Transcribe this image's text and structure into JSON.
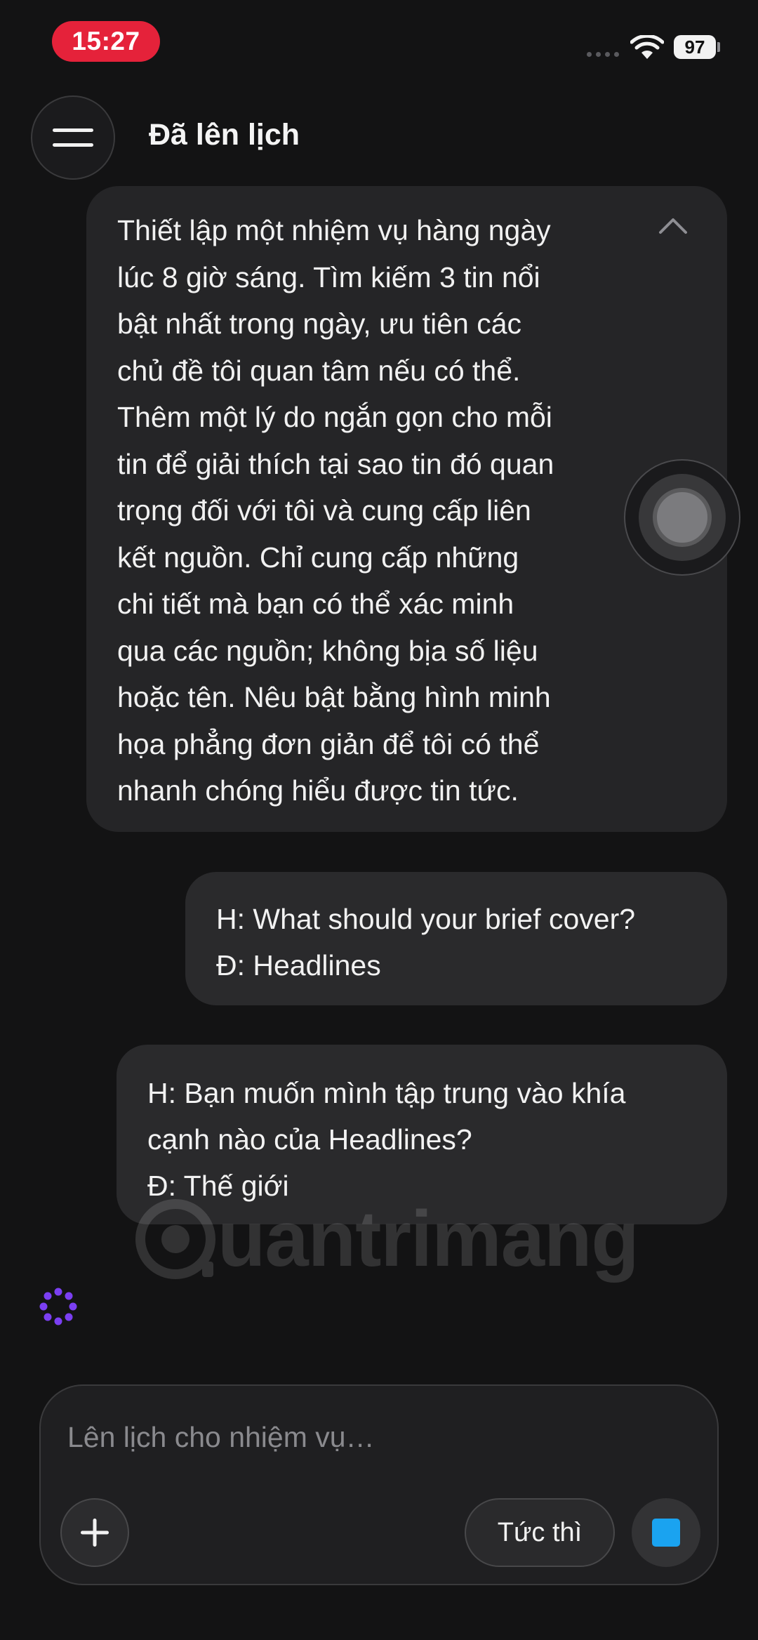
{
  "status_bar": {
    "time": "15:27",
    "battery": "97"
  },
  "header": {
    "title": "Đã lên lịch",
    "menu_icon": "hamburger-icon"
  },
  "prompt": {
    "lines": [
      "Thiết lập một nhiệm vụ hàng ngày",
      "lúc 8 giờ sáng. Tìm kiếm 3 tin nổi",
      "bật nhất trong ngày, ưu tiên các",
      "chủ đề tôi quan tâm nếu có thể.",
      "Thêm một lý do ngắn gọn cho mỗi",
      "tin để giải thích tại sao tin đó quan",
      "trọng đối với tôi và cung cấp liên",
      "kết nguồn. Chỉ cung cấp những",
      "chi tiết mà bạn có thể xác minh",
      "qua các nguồn; không bịa số liệu",
      "hoặc tên. Nêu bật bằng hình minh",
      "họa phẳng đơn giản để tôi có thể",
      "nhanh chóng hiểu được tin tức."
    ],
    "collapse_icon": "chevron-up-icon"
  },
  "messages": [
    {
      "lines": [
        "H: What should your brief cover?",
        "Đ: Headlines"
      ]
    },
    {
      "lines": [
        "H: Bạn muốn mình tập trung vào khía",
        "cạnh nào của Headlines?",
        "Đ: Thế giới"
      ]
    }
  ],
  "watermark": {
    "text": "uantrimang"
  },
  "composer": {
    "placeholder": "Lên lịch cho nhiệm vụ…",
    "value": "",
    "instant_label": "Tức thì",
    "add_icon": "plus-icon",
    "stop_icon": "stop-icon"
  },
  "colors": {
    "background": "#131314",
    "time_pill": "#e5223a",
    "stop_square": "#1aa3f0",
    "spinner": "#7b3ff2"
  }
}
